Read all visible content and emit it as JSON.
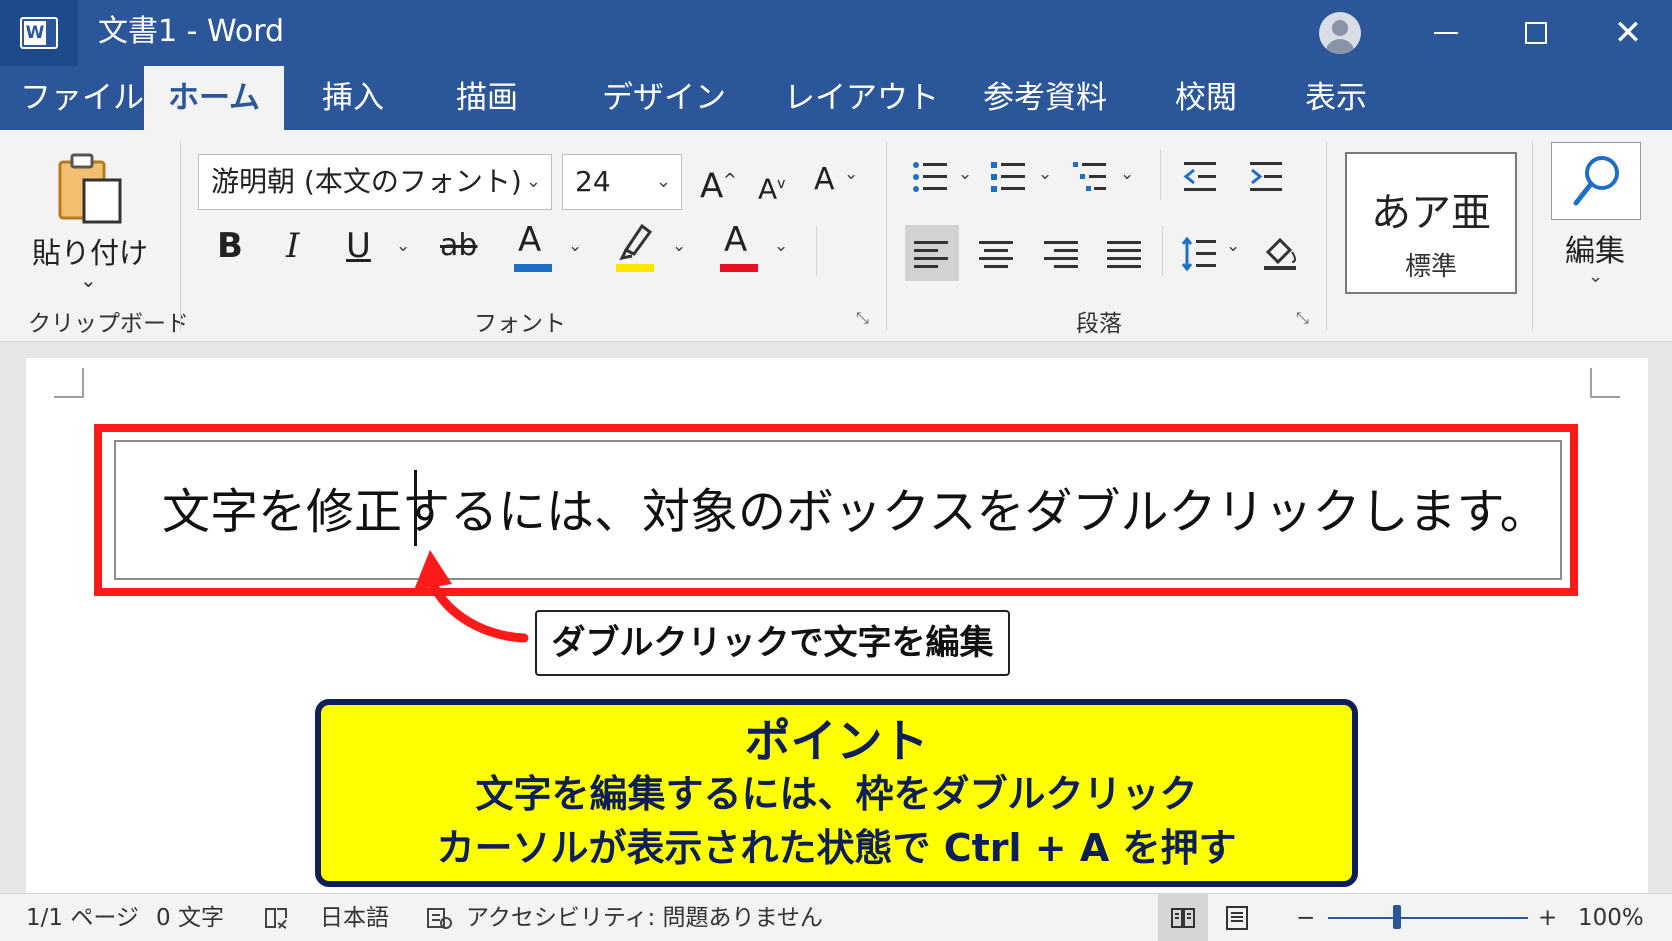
{
  "window": {
    "title": "文書1  -  Word",
    "logo_icon": "word-logo-icon",
    "logo_letter": "W",
    "minimize_icon": "minimize-icon",
    "maximize_icon": "maximize-icon",
    "close_icon": "close-icon",
    "close_glyph": "✕"
  },
  "tabs": [
    {
      "label": "ファイル"
    },
    {
      "label": "ホーム",
      "active": true
    },
    {
      "label": "挿入"
    },
    {
      "label": "描画"
    },
    {
      "label": "デザイン"
    },
    {
      "label": "レイアウト"
    },
    {
      "label": "参考資料"
    },
    {
      "label": "校閲"
    },
    {
      "label": "表示"
    }
  ],
  "ribbon": {
    "clipboard": {
      "paste_label": "貼り付け",
      "group_label": "クリップボード",
      "chevron": "⌄"
    },
    "font": {
      "font_name": "游明朝 (本文のフォント)",
      "font_size": "24",
      "grow_font": "A",
      "shrink_font": "A",
      "change_case": "A",
      "bold": "B",
      "italic": "I",
      "underline": "U",
      "strikethrough": "ab",
      "font_color_letter": "A",
      "char_shade_letter": "A",
      "group_label": "フォント",
      "colors": {
        "font_color": "#1f6fc6",
        "highlight": "#ffe600",
        "shade": "#e81123"
      }
    },
    "paragraph": {
      "group_label": "段落"
    },
    "styles": {
      "sample": "あア亜",
      "name": "標準"
    },
    "editing": {
      "label": "編集",
      "chevron": "⌄"
    },
    "dropdown_chevron": "⌄",
    "launcher_glyph": "⤡"
  },
  "document": {
    "textbox_text": "文字を修正するには、対象のボックスをダブルクリックします。",
    "callout": "ダブルクリックで文字を編集",
    "point_title": "ポイント",
    "point_line1": "文字を編集するには、枠をダブルクリック",
    "point_line2": "カーソルが表示された状態で Ctrl + A を押す",
    "colors": {
      "frame": "#ff1a1a",
      "point_bg": "#ffff00",
      "point_border": "#0e1f57"
    }
  },
  "status": {
    "page": "1/1 ページ",
    "words": "0 文字",
    "language": "日本語",
    "accessibility": "アクセシビリティ: 問題ありません",
    "zoom_minus": "−",
    "zoom_plus": "+",
    "zoom": "100%"
  }
}
